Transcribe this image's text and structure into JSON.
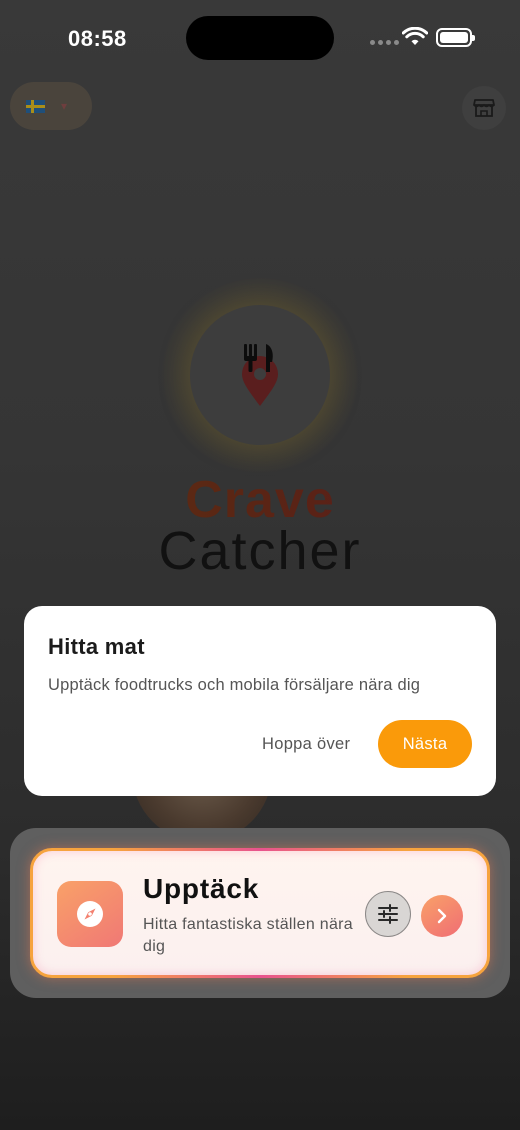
{
  "status_bar": {
    "time": "08:58",
    "icons": [
      "signal-dots-icon",
      "wifi-icon",
      "battery-icon"
    ]
  },
  "header": {
    "language_flag": "swedish-flag-icon",
    "language_chevron": "chevron-down-icon",
    "store_icon": "storefront-icon"
  },
  "brand": {
    "logo_icon": "fork-knife-pin-icon",
    "name_part1": "Crave",
    "name_part2": "Catcher"
  },
  "tooltip": {
    "title": "Hitta mat",
    "body": "Upptäck foodtrucks och mobila försäljare nära dig",
    "skip_label": "Hoppa över",
    "next_label": "Nästa"
  },
  "discover_card": {
    "icon": "compass-icon",
    "title": "Upptäck",
    "subtitle": "Hitta fantastiska ställen nära dig",
    "filter_icon": "sliders-icon",
    "go_icon": "chevron-right-icon"
  },
  "colors": {
    "accent_orange": "#fa9a0a",
    "gradient_start": "#f9a168",
    "gradient_end": "#f07875",
    "highlight_pink": "#e8538e"
  }
}
